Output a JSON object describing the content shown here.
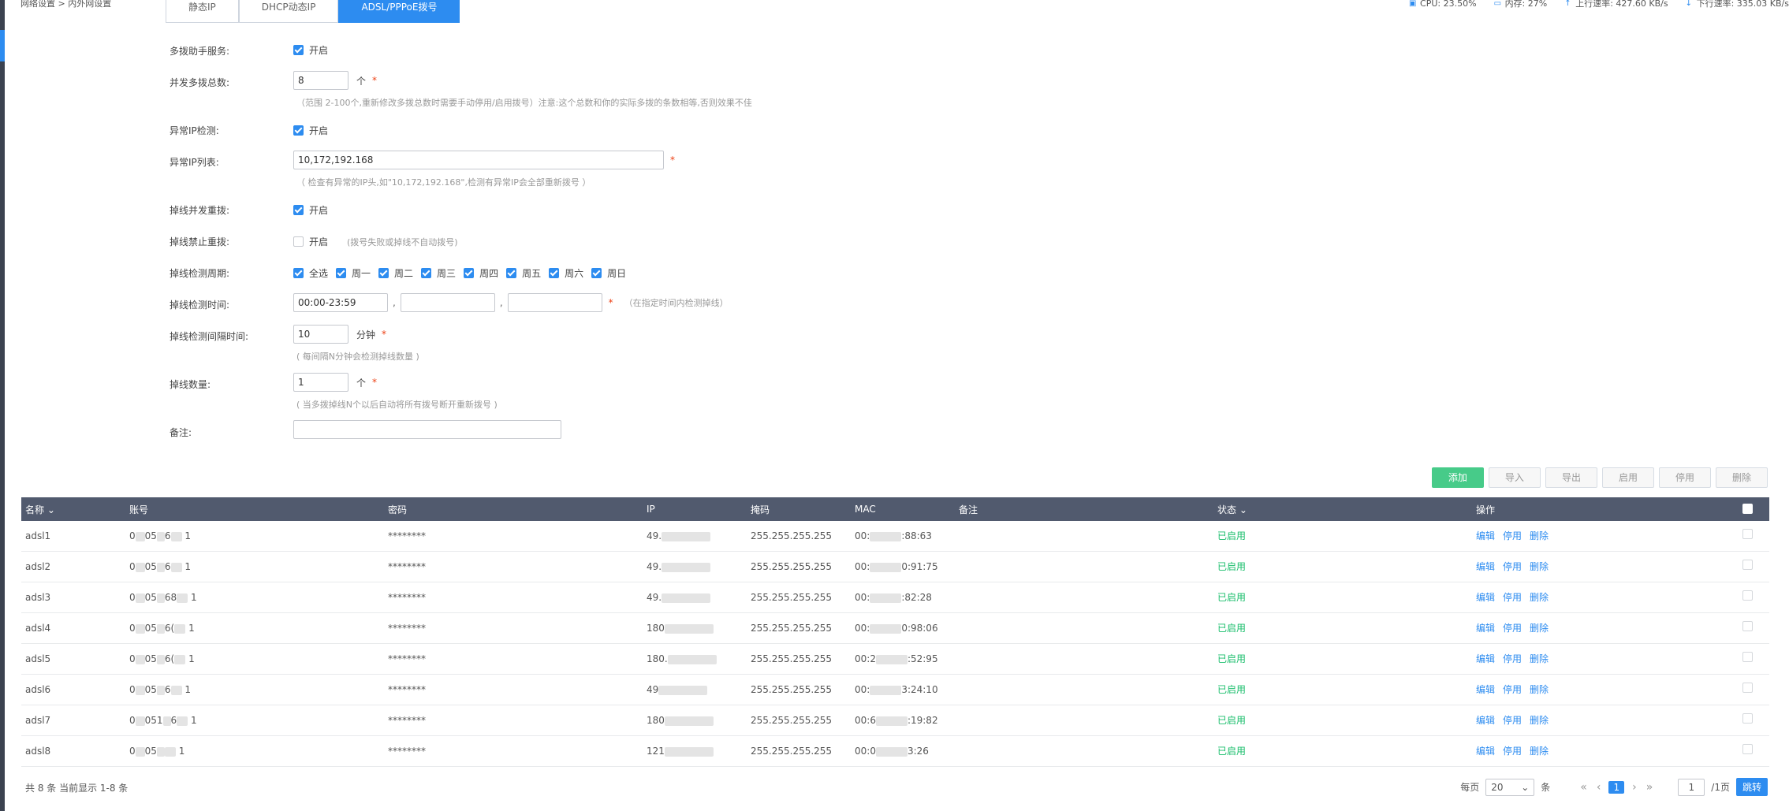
{
  "breadcrumb": "网络设置 > 内外网设置",
  "stats": {
    "cpu": "CPU: 23.50%",
    "mem": "内存: 27%",
    "up": "上行速率: 427.60 KB/s",
    "down": "下行速率: 335.03 KB/s"
  },
  "tabs": [
    "静态IP",
    "DHCP动态IP",
    "ADSL/PPPoE拨号"
  ],
  "form": {
    "multi_dial": {
      "label": "多拨助手服务:",
      "text": "开启",
      "checked": true
    },
    "concurrent_total": {
      "label": "并发多拨总数:",
      "value": "8",
      "unit": "个",
      "req": "*",
      "hint": "（范围 2-100个,重新修改多拨总数时需要手动停用/启用拨号）注意:这个总数和你的实际多拨的条数相等,否则效果不佳"
    },
    "abnormal_ip_check": {
      "label": "异常IP检测:",
      "text": "开启",
      "checked": true
    },
    "abnormal_ip_list": {
      "label": "异常IP列表:",
      "value": "10,172,192.168",
      "req": "*",
      "hint": "（ 检查有异常的IP头,如\"10,172,192.168\",检测有异常IP会全部重新拨号 ）"
    },
    "drop_redial": {
      "label": "掉线并发重拨:",
      "text": "开启",
      "checked": true
    },
    "drop_no_redial": {
      "label": "掉线禁止重拨:",
      "text": "开启",
      "checked": false,
      "hint": "(拨号失败或掉线不自动拨号)"
    },
    "drop_cycle": {
      "label": "掉线检测周期:",
      "days": [
        "全选",
        "周一",
        "周二",
        "周三",
        "周四",
        "周五",
        "周六",
        "周日"
      ]
    },
    "drop_time": {
      "label": "掉线检测时间:",
      "value1": "00:00-23:59",
      "value2": "",
      "value3": "",
      "sep": ",",
      "req": "*",
      "hint": "（在指定时间内检测掉线）"
    },
    "drop_interval": {
      "label": "掉线检测间隔时间:",
      "value": "10",
      "unit": "分钟",
      "req": "*",
      "hint": "( 每间隔N分钟会检测掉线数量 )"
    },
    "drop_count": {
      "label": "掉线数量:",
      "value": "1",
      "unit": "个",
      "req": "*",
      "hint": "( 当多拨掉线N个以后自动将所有拨号断开重新拨号 )"
    },
    "remark": {
      "label": "备注:",
      "value": ""
    }
  },
  "buttons": {
    "add": "添加",
    "import": "导入",
    "export": "导出",
    "enable": "启用",
    "disable": "停用",
    "delete": "删除"
  },
  "table": {
    "headers": {
      "name": "名称",
      "account": "账号",
      "password": "密码",
      "ip": "IP",
      "mask": "掩码",
      "mac": "MAC",
      "remark": "备注",
      "status": "状态",
      "ops": "操作"
    },
    "rows": [
      {
        "name": "adsl1",
        "acc_a": "0",
        "acc_b": "05",
        "acc_c": "6",
        "acc_d": "1",
        "pwd": "********",
        "ip": "49.",
        "mask": "255.255.255.255",
        "mac_a": "00:",
        "mac_b": ":88:63",
        "status": "已启用"
      },
      {
        "name": "adsl2",
        "acc_a": "0",
        "acc_b": "05",
        "acc_c": "6",
        "acc_d": "1",
        "pwd": "********",
        "ip": "49.",
        "mask": "255.255.255.255",
        "mac_a": "00:",
        "mac_b": "0:91:75",
        "status": "已启用"
      },
      {
        "name": "adsl3",
        "acc_a": "0",
        "acc_b": "05",
        "acc_c": "68",
        "acc_d": "1",
        "pwd": "********",
        "ip": "49.",
        "mask": "255.255.255.255",
        "mac_a": "00:",
        "mac_b": ":82:28",
        "status": "已启用"
      },
      {
        "name": "adsl4",
        "acc_a": "0",
        "acc_b": "05",
        "acc_c": "6(",
        "acc_d": "1",
        "pwd": "********",
        "ip": "180",
        "mask": "255.255.255.255",
        "mac_a": "00:",
        "mac_b": "0:98:06",
        "status": "已启用"
      },
      {
        "name": "adsl5",
        "acc_a": "0",
        "acc_b": "05",
        "acc_c": "6(",
        "acc_d": "1",
        "pwd": "********",
        "ip": "180.",
        "mask": "255.255.255.255",
        "mac_a": "00:2",
        "mac_b": ":52:95",
        "status": "已启用"
      },
      {
        "name": "adsl6",
        "acc_a": "0",
        "acc_b": "05",
        "acc_c": "6",
        "acc_d": "1",
        "pwd": "********",
        "ip": "49",
        "mask": "255.255.255.255",
        "mac_a": "00:",
        "mac_b": "3:24:10",
        "status": "已启用"
      },
      {
        "name": "adsl7",
        "acc_a": "0",
        "acc_b": "051",
        "acc_c": "6",
        "acc_d": "1",
        "pwd": "********",
        "ip": "180",
        "mask": "255.255.255.255",
        "mac_a": "00:6",
        "mac_b": ":19:82",
        "status": "已启用"
      },
      {
        "name": "adsl8",
        "acc_a": "0",
        "acc_b": "05",
        "acc_c": "",
        "acc_d": "1",
        "pwd": "********",
        "ip": "121",
        "mask": "255.255.255.255",
        "mac_a": "00:0",
        "mac_b": "3:26",
        "status": "已启用"
      }
    ],
    "ops": [
      "编辑",
      "停用",
      "删除"
    ]
  },
  "pager": {
    "total": "共 8 条 当前显示 1-8 条",
    "per_page_label": "每页",
    "per_page": "20",
    "per_page_unit": "条",
    "current": "1",
    "jump_value": "1",
    "pages_label": "/1页",
    "go": "跳转"
  }
}
